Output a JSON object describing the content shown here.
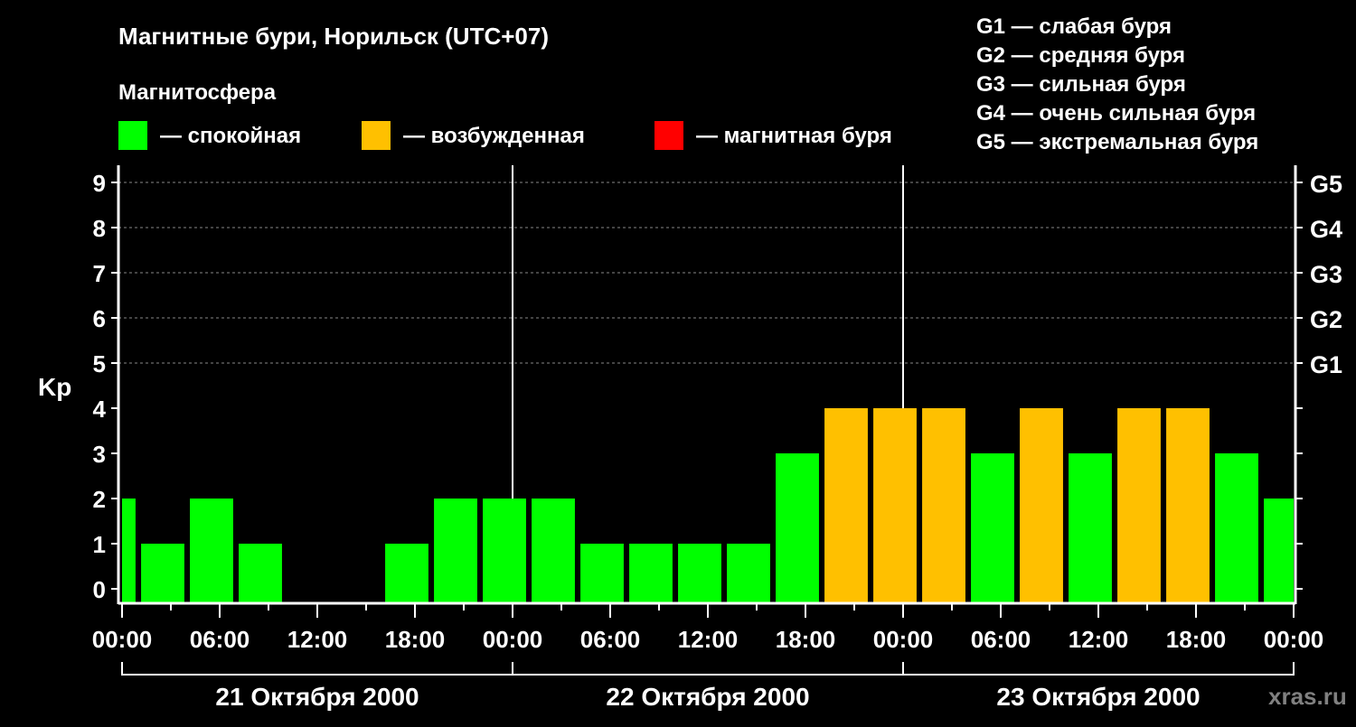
{
  "title": "Магнитные бури, Норильск (UTC+07)",
  "legend": {
    "heading": "Магнитосфера",
    "items": [
      {
        "label": "— спокойная",
        "color": "#00ff00"
      },
      {
        "label": "— возбужденная",
        "color": "#ffc000"
      },
      {
        "label": "— магнитная буря",
        "color": "#ff0000"
      }
    ]
  },
  "g_scale": [
    "G1 — слабая буря",
    "G2 — средняя буря",
    "G3 — сильная буря",
    "G4 — очень сильная буря",
    "G5 — экстремальная буря"
  ],
  "watermark": "xras.ru",
  "chart_data": {
    "type": "bar",
    "title": "Магнитные бури, Норильск (UTC+07)",
    "ylabel": "Kp",
    "ylim": [
      -0.32,
      9.38
    ],
    "yticks": [
      "0",
      "1",
      "2",
      "3",
      "4",
      "5",
      "6",
      "7",
      "8",
      "9"
    ],
    "right_ticks": [
      {
        "value": 5,
        "label": "G1"
      },
      {
        "value": 6,
        "label": "G2"
      },
      {
        "value": 7,
        "label": "G3"
      },
      {
        "value": 8,
        "label": "G4"
      },
      {
        "value": 9,
        "label": "G5"
      }
    ],
    "xlim_hours": [
      0,
      72
    ],
    "xticks": [
      "00:00",
      "06:00",
      "12:00",
      "18:00",
      "00:00",
      "06:00",
      "12:00",
      "18:00",
      "00:00",
      "06:00",
      "12:00",
      "18:00",
      "00:00"
    ],
    "days": [
      "21 Октября 2000",
      "22 Октября 2000",
      "23 Октября 2000"
    ],
    "bar_interval_hours": 3,
    "first_bar_start_hour": -2,
    "values": [
      2,
      1,
      2,
      1,
      0,
      0,
      1,
      2,
      2,
      2,
      1,
      1,
      1,
      1,
      3,
      4,
      4,
      4,
      3,
      4,
      3,
      4,
      4,
      3,
      2
    ],
    "colors": {
      "quiet": "#00ff00",
      "active": "#ffc000",
      "storm": "#ff0000"
    }
  }
}
